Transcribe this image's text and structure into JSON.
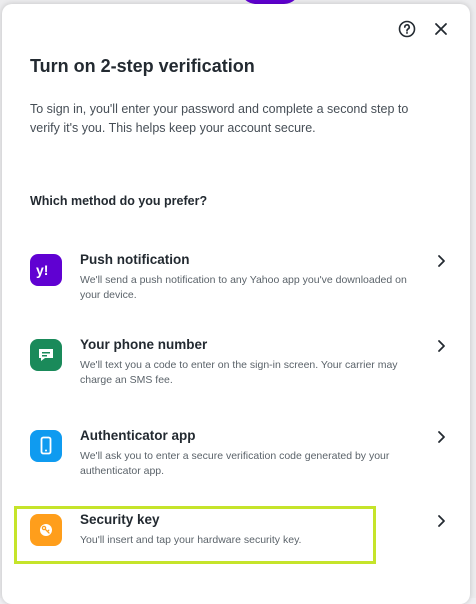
{
  "dialog": {
    "title": "Turn on 2-step verification",
    "description": "To sign in, you'll enter your password and complete a second step to verify it's you. This helps keep your account secure.",
    "question": "Which method do you prefer?",
    "help_icon": "help-circle-icon",
    "close_icon": "close-icon"
  },
  "options": [
    {
      "title": "Push notification",
      "description": "We'll send a push notification to any Yahoo app you've downloaded on your device.",
      "icon": "yahoo-icon",
      "color": "#6001d2"
    },
    {
      "title": "Your phone number",
      "description": "We'll text you a code to enter on the sign-in screen. Your carrier may charge an SMS fee.",
      "icon": "message-icon",
      "color": "#1a8a5a"
    },
    {
      "title": "Authenticator app",
      "description": "We'll ask you to enter a secure verification code generated by your authenticator app.",
      "icon": "phone-icon",
      "color": "#0f9bf0"
    },
    {
      "title": "Security key",
      "description": "You'll insert and tap your hardware security key.",
      "icon": "key-icon",
      "color": "#ff9e1b"
    }
  ],
  "colors": {
    "highlight": "#c5e42a",
    "text_primary": "#232a31",
    "text_secondary": "#5b636a"
  }
}
